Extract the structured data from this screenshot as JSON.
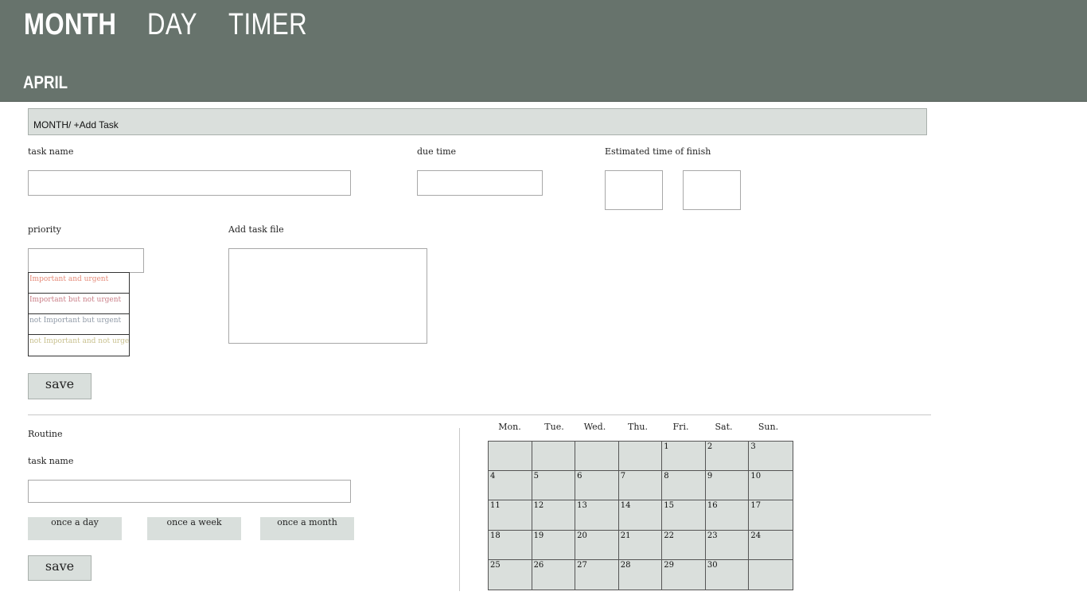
{
  "nav": {
    "tabs": [
      {
        "label": "MONTH",
        "active": true
      },
      {
        "label": "DAY",
        "active": false
      },
      {
        "label": "TIMER",
        "active": false
      }
    ],
    "current_month": "APRIL"
  },
  "breadcrumb": "MONTH/ +Add Task",
  "task_form": {
    "task_name_label": "task name",
    "task_name_value": "",
    "due_time_label": "due time",
    "due_time_value": "",
    "estimated_label": "Estimated  time of finish",
    "estimated_value_1": "",
    "estimated_value_2": "",
    "priority_label": "priority",
    "priority_value": "",
    "priority_options": [
      {
        "label": "Important and urgent",
        "color": "#e58a78"
      },
      {
        "label": "Important but not urgent",
        "color": "#c97d86"
      },
      {
        "label": "not Important but urgent",
        "color": "#8f99a6"
      },
      {
        "label": "not Important and  not urgent",
        "color": "#c8c08e"
      }
    ],
    "add_file_label": "Add task file",
    "save_label": "save"
  },
  "routine": {
    "title": "Routine",
    "task_name_label": "task name",
    "task_name_value": "",
    "frequency_options": [
      "once a day",
      "once a week",
      "once a month"
    ],
    "save_label": "save"
  },
  "calendar": {
    "weekdays": [
      "Mon.",
      "Tue.",
      "Wed.",
      "Thu.",
      "Fri.",
      "Sat.",
      "Sun."
    ],
    "days": [
      "",
      "",
      "",
      "",
      "1",
      "2",
      "3",
      "4",
      "5",
      "6",
      "7",
      "8",
      "9",
      "10",
      "11",
      "12",
      "13",
      "14",
      "15",
      "16",
      "17",
      "18",
      "19",
      "20",
      "21",
      "22",
      "23",
      "24",
      "25",
      "26",
      "27",
      "28",
      "29",
      "30",
      ""
    ]
  },
  "colors": {
    "header_bg": "#67736c",
    "panel_bg": "#dadfdc"
  }
}
